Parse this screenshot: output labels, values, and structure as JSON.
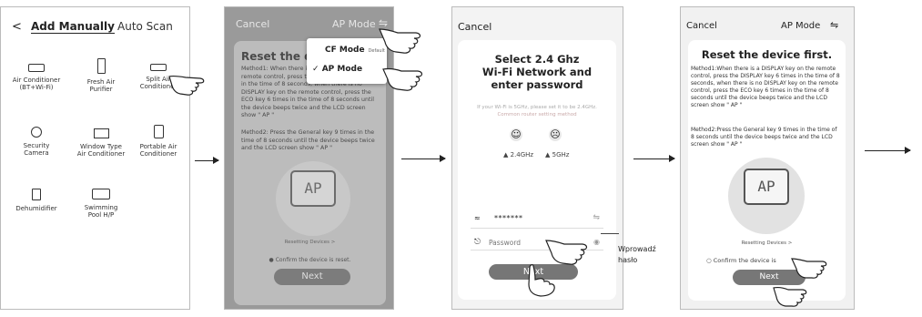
{
  "panel1": {
    "back": "<",
    "tab_manual": "Add Manually",
    "tab_auto": "Auto Scan",
    "devices": [
      {
        "label": "Air Conditioner\n(BT+Wi-Fi)"
      },
      {
        "label": "Fresh Air\nPurifier"
      },
      {
        "label": "Split Air\nConditioner"
      },
      {
        "label": "Security\nCamera"
      },
      {
        "label": "Window Type\nAir Conditioner"
      },
      {
        "label": "Portable Air\nConditioner"
      },
      {
        "label": "Dehumidifier"
      },
      {
        "label": "Swimming\nPool H/P"
      }
    ]
  },
  "panel2": {
    "cancel": "Cancel",
    "ap_mode": "AP Mode",
    "switch": "⇋",
    "title": "Reset the d",
    "method1": "Method1: When there is a DISPLAY key on the remote control, press the DISPLAY key 6 times in the time of 8 seconds, when there is no DISPLAY key on the remote control, press the ECO key 6 times in the time of 8 seconds until the device beeps twice and the LCD screen show \" AP \"",
    "method2": "Method2: Press the General key 9 times in the time of 8 seconds until the device beeps twice and the LCD screen show \" AP \"",
    "lcd": "AP",
    "resetting": "Resetting Devices >",
    "confirm": "Confirm the device is reset.",
    "next": "Next",
    "menu": {
      "cf_mode": "CF Mode",
      "cf_default": "Default",
      "ap_mode": "AP Mode",
      "check": "✓"
    }
  },
  "panel3": {
    "cancel": "Cancel",
    "title": "Select 2.4 Ghz\nWi-Fi Network and\nenter password",
    "note": "If your Wi-Fi is 5GHz, please set it to be 2.4GHz.",
    "note_link": "Common router setting method",
    "band_ok": "2.4GHz",
    "band_bad": "5GHz",
    "face_ok": "☺",
    "face_bad": "☹",
    "wifi_icon": "wifi-icon",
    "wifi_value": "*******",
    "password_placeholder": "Password",
    "next": "Next",
    "callout": "Wprowadź\nhasło"
  },
  "panel4": {
    "cancel": "Cancel",
    "ap_mode": "AP Mode",
    "switch": "⇋",
    "title": "Reset the device first.",
    "method1": "Method1:When there is a DISPLAY key on the remote control, press the DISPLAY key 6 times in the time of 8 seconds, when there is no DISPLAY key on the remote control, press the ECO key 6 times in the time of 8 seconds until the device beeps twice and the LCD screen show \" AP \"",
    "method2": "Method2:Press the General key 9 times in the time of 8 seconds until the device beeps twice and the LCD screen show \" AP \"",
    "lcd": "AP",
    "resetting": "Resetting Devices >",
    "confirm": "Confirm the device is",
    "next": "Next"
  }
}
